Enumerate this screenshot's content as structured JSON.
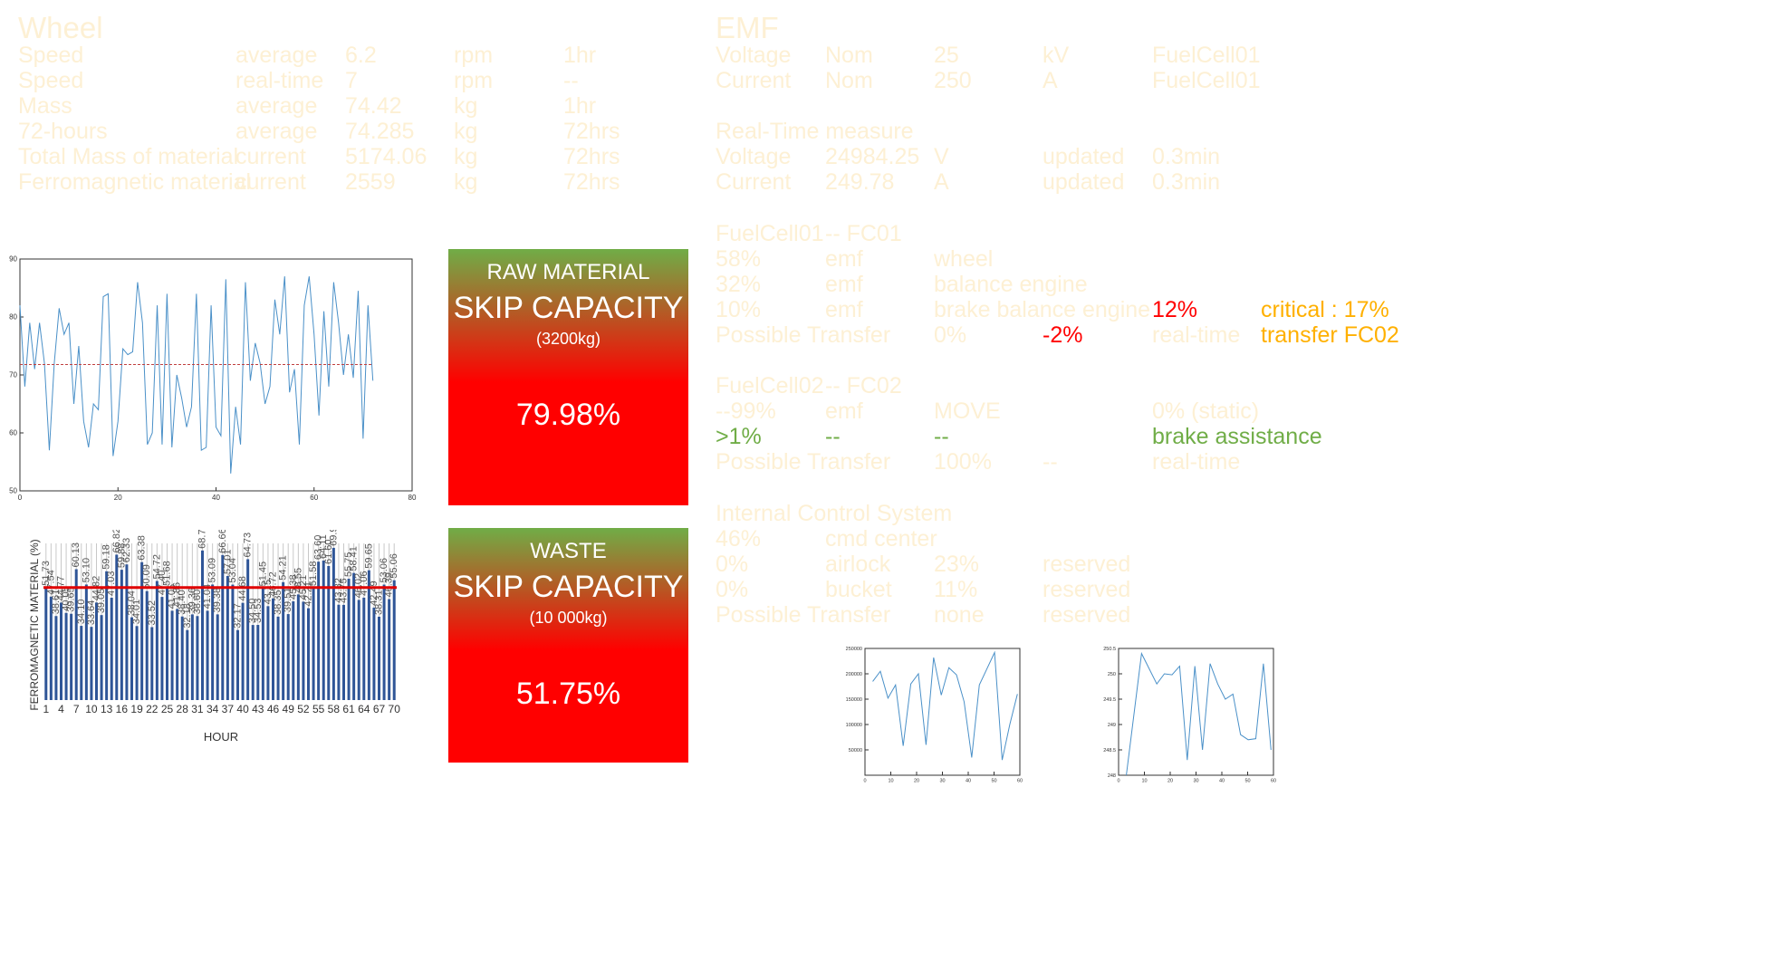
{
  "wheel": {
    "title": "Wheel",
    "rows": [
      [
        "Speed",
        "average",
        "6.2",
        "rpm",
        "1hr"
      ],
      [
        "Speed",
        "real-time",
        "7",
        "rpm",
        "--"
      ],
      [
        "Mass",
        "average",
        "74.42",
        "kg",
        "1hr"
      ],
      [
        "72-hours",
        "average",
        "74.285",
        "kg",
        "72hrs"
      ],
      [
        "Total Mass of material",
        "current",
        "5174.06",
        "kg",
        "72hrs"
      ],
      [
        "Ferromagnetic material",
        "current",
        "2559",
        "kg",
        "72hrs"
      ]
    ]
  },
  "emf": {
    "title": "EMF",
    "nominal": [
      [
        "Voltage",
        "Nom",
        "25",
        "kV",
        "FuelCell01"
      ],
      [
        "Current",
        "Nom",
        "250",
        "A",
        "FuelCell01"
      ]
    ],
    "rt_title": "Real-Time measure",
    "realtime": [
      [
        "Voltage",
        "24984.25",
        "V",
        "updated",
        "0.3min"
      ],
      [
        "Current",
        "249.78",
        "A",
        "updated",
        "0.3min"
      ]
    ],
    "fc01": {
      "title": [
        "FuelCell01",
        "-- FC01"
      ],
      "rows": [
        [
          "58%",
          "emf",
          "wheel"
        ],
        [
          "32%",
          "emf",
          "balance engine"
        ],
        [
          "10%",
          "emf",
          "brake balance engine"
        ]
      ],
      "alert_pct": "12%",
      "critical": "critical : 17%",
      "transfer": [
        "Possible Transfer",
        "0%",
        "-2%",
        "real-time",
        "transfer FC02"
      ]
    },
    "fc02": {
      "title": [
        "FuelCell02",
        "-- FC02"
      ],
      "row1": [
        "--99%",
        "emf",
        "MOVE",
        "0% (static)"
      ],
      "row2": [
        ">1%",
        "--",
        "--",
        "brake assistance"
      ],
      "transfer": [
        "Possible Transfer",
        "100%",
        "--",
        "real-time"
      ]
    },
    "ics": {
      "title": "Internal Control System",
      "row1": [
        "46%",
        "cmd center"
      ],
      "rows": [
        [
          "0%",
          "airlock",
          "23%",
          "reserved"
        ],
        [
          "0%",
          "bucket",
          "11%",
          "reserved"
        ]
      ],
      "transfer": [
        "Possible Transfer",
        "none",
        "reserved"
      ]
    }
  },
  "skips": [
    {
      "line1": "RAW MATERIAL",
      "line2": "SKIP CAPACITY",
      "line3": "(3200kg)",
      "value": "79.98%"
    },
    {
      "line1": "WASTE",
      "line2": "SKIP CAPACITY",
      "line3": "(10 000kg)",
      "value": "51.75%"
    }
  ],
  "colors": {
    "faint_text": "#fdf0d4",
    "alert": "#ff0000",
    "warning": "#ffb000",
    "ok": "#70ad47",
    "line": "#4a90c8",
    "bar": "#2f5597"
  },
  "chart_data": [
    {
      "type": "line",
      "xlim": [
        0,
        80
      ],
      "ylim": [
        50,
        90
      ],
      "xticks": [
        "0",
        "20",
        "40",
        "60",
        "80"
      ],
      "yticks": [
        "50",
        "60",
        "70",
        "80",
        "90"
      ],
      "mean_line": 71.8,
      "y": [
        82,
        68,
        79,
        71,
        79,
        72,
        57,
        72,
        81.5,
        77,
        79,
        65,
        75,
        62,
        57.5,
        65,
        64,
        83.5,
        84,
        56,
        62,
        74.5,
        73.5,
        74,
        86,
        79,
        58,
        60,
        82,
        58,
        84,
        57.5,
        70,
        66,
        61,
        64.5,
        84,
        57,
        57.5,
        82,
        61,
        59.5,
        86.5,
        53,
        64.5,
        58,
        86,
        69,
        75.5,
        72,
        65,
        68,
        83,
        77,
        87,
        67,
        71,
        58,
        82,
        87,
        77,
        63,
        81,
        68,
        86,
        79,
        70,
        77,
        69.5,
        84.5,
        59,
        82,
        69
      ]
    },
    {
      "type": "bar",
      "ylabel": "FERROMAGNETIC MATERIAL (%)",
      "xlabel": "HOUR",
      "xticks": [
        "1",
        "4",
        "7",
        "10",
        "13",
        "16",
        "19",
        "22",
        "25",
        "28",
        "31",
        "34",
        "37",
        "40",
        "43",
        "46",
        "49",
        "52",
        "55",
        "58",
        "61",
        "64",
        "67",
        "70"
      ],
      "mean_line": 51.73,
      "labels": [
        "51.73",
        "47.54",
        "38.61",
        "44.77",
        "40.05",
        "39.65",
        "60.13",
        "34.10",
        "53.10",
        "33.64",
        "44.82",
        "39.05",
        "59.18",
        "47.03",
        "66.82",
        "59.88",
        "62.33",
        "38.04",
        "34.01",
        "63.38",
        "50.09",
        "33.52",
        "54.72",
        "47.40",
        "51.68",
        "41.05",
        "41.86",
        "38.40",
        "32.18",
        "39.36",
        "38.60",
        "68.74",
        "41.04",
        "53.09",
        "39.38",
        "66.66",
        "57.01",
        "53.04",
        "32.17",
        "44.68",
        "64.73",
        "34.50",
        "34.53",
        "51.45",
        "43.15",
        "46.72",
        "38.35",
        "54.21",
        "39.51",
        "45.38",
        "48.55",
        "45.21",
        "42.21",
        "51.58",
        "63.60",
        "64.11",
        "61.60",
        "69.96",
        "43.82",
        "43.75",
        "55.75",
        "58.41",
        "46.02",
        "47.06",
        "59.65",
        "42.49",
        "38.31",
        "53.06",
        "46.39",
        "55.06"
      ]
    },
    {
      "type": "line",
      "xlim": [
        0,
        60
      ],
      "ylim": [
        0,
        250000
      ],
      "xticks": [
        "0",
        "10",
        "20",
        "30",
        "40",
        "50",
        "60"
      ],
      "yticks": [
        "50000",
        "100000",
        "150000",
        "200000",
        "250000"
      ],
      "y": [
        185000,
        205000,
        152000,
        178000,
        58000,
        180000,
        200000,
        60000,
        232000,
        158000,
        212000,
        198000,
        145000,
        35000,
        178000,
        210000,
        242000,
        30000,
        100000,
        160000
      ]
    },
    {
      "type": "line",
      "xlim": [
        0,
        60
      ],
      "ylim": [
        248,
        250.5
      ],
      "xticks": [
        "0",
        "10",
        "20",
        "30",
        "40",
        "50",
        "60"
      ],
      "yticks": [
        "248",
        "248.5",
        "249",
        "249.5",
        "250",
        "250.5"
      ],
      "y": [
        248,
        249.2,
        250.4,
        250.1,
        249.8,
        250,
        249.98,
        250.15,
        248.3,
        250.15,
        248.5,
        250.2,
        249.8,
        249.5,
        249.6,
        248.8,
        248.7,
        248.72,
        250.2,
        248.5
      ]
    }
  ]
}
